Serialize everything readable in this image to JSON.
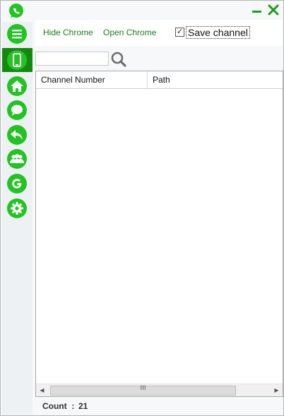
{
  "colors": {
    "accent": "#22c323",
    "accent_dark": "#138a0f",
    "link": "#1b7d19"
  },
  "title_bar": {
    "logo_icon": "whatsapp-icon",
    "minimize_icon": "minimize-icon",
    "close_icon": "close-icon"
  },
  "sidebar": {
    "items": [
      {
        "icon": "menu-icon",
        "active": false
      },
      {
        "icon": "phone-icon",
        "active": true
      },
      {
        "icon": "home-icon",
        "active": false
      },
      {
        "icon": "chat-icon",
        "active": false
      },
      {
        "icon": "reply-icon",
        "active": false
      },
      {
        "icon": "group-icon",
        "active": false
      },
      {
        "icon": "g-letter-icon",
        "active": false
      },
      {
        "icon": "settings-icon",
        "active": false
      }
    ]
  },
  "toolbar": {
    "hide_chrome_label": "Hide Chrome",
    "open_chrome_label": "Open Chrome",
    "save_channel_label": "Save channel",
    "save_channel_checked": true
  },
  "search": {
    "value": "",
    "placeholder": "",
    "icon": "search-icon"
  },
  "table": {
    "columns": [
      "Channel Number",
      "Path"
    ],
    "rows": [],
    "scroll_grip": "III"
  },
  "footer": {
    "count_label": "Count  :",
    "count_value": "21"
  }
}
